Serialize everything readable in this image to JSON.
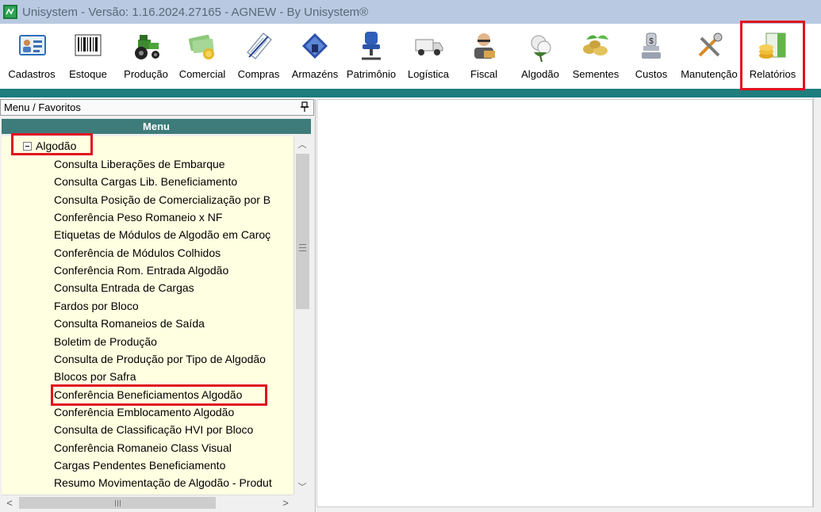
{
  "window": {
    "title": "Unisystem - Versão: 1.16.2024.27165 - AGNEW - By Unisystem®"
  },
  "toolbar": {
    "items": [
      {
        "label": "Cadastros",
        "icon": "id-card-icon"
      },
      {
        "label": "Estoque",
        "icon": "barcode-icon"
      },
      {
        "label": "Produção",
        "icon": "tractor-icon"
      },
      {
        "label": "Comercial",
        "icon": "money-icon"
      },
      {
        "label": "Compras",
        "icon": "pen-paper-icon"
      },
      {
        "label": "Armazéns",
        "icon": "warehouse-icon"
      },
      {
        "label": "Patrimônio",
        "icon": "chair-icon"
      },
      {
        "label": "Logística",
        "icon": "truck-icon"
      },
      {
        "label": "Fiscal",
        "icon": "inspector-icon"
      },
      {
        "label": "Algodão",
        "icon": "cotton-icon"
      },
      {
        "label": "Sementes",
        "icon": "seeds-icon"
      },
      {
        "label": "Custos",
        "icon": "cost-icon"
      },
      {
        "label": "Manutenção",
        "icon": "tools-icon"
      },
      {
        "label": "Relatórios",
        "icon": "reports-icon"
      }
    ]
  },
  "panel": {
    "header": "Menu / Favoritos",
    "menu_title": "Menu",
    "root_label": "Algodão",
    "items": [
      "Consulta Liberações de Embarque",
      "Consulta Cargas Lib. Beneficiamento",
      "Consulta Posição de Comercialização por B",
      "Conferência Peso Romaneio x NF",
      "Etiquetas de Módulos de Algodão em Caroç",
      "Conferência de Módulos Colhidos",
      "Conferência Rom. Entrada Algodão",
      "Consulta Entrada de Cargas",
      "Fardos por Bloco",
      "Consulta Romaneios de Saída",
      "Boletim de Produção",
      "Consulta de Produção por Tipo de Algodão",
      "Blocos por Safra",
      "Conferência Beneficiamentos Algodão",
      "Conferência Emblocamento Algodão",
      "Consulta de Classificação HVI por Bloco",
      "Conferência Romaneio Class Visual",
      "Cargas Pendentes Beneficiamento",
      "Resumo Movimentação de Algodão - Produt"
    ]
  },
  "colors": {
    "highlight": "#e0141e",
    "menu_header": "#3d7c7b",
    "menu_background": "#ffffe1",
    "teal_strip": "#1e7d7d"
  }
}
